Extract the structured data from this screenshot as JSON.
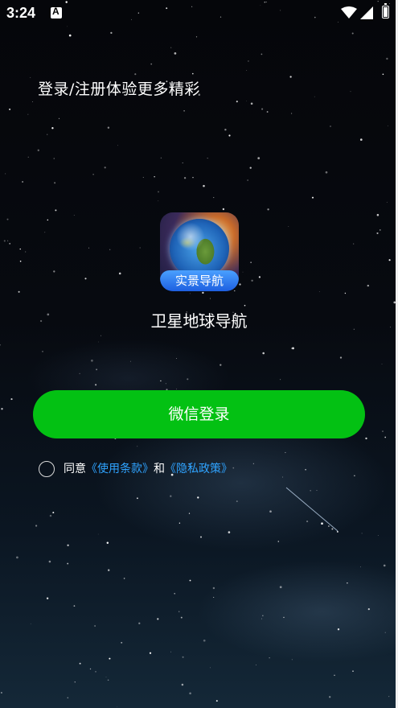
{
  "status_bar": {
    "time": "3:24",
    "icons": [
      "notification-a-icon",
      "wifi-icon",
      "signal-icon",
      "battery-charging-icon"
    ]
  },
  "headline": "登录/注册体验更多精彩",
  "app": {
    "icon_name": "globe-app-icon",
    "icon_badge": "实景导航",
    "name": "卫星地球导航"
  },
  "login_button": {
    "label": "微信登录",
    "color": "#03c113"
  },
  "agreement": {
    "prefix": "同意",
    "terms_link": "《使用条款》",
    "conjunction": "和",
    "privacy_link": "《隐私政策》",
    "link_color": "#2fa3ff"
  }
}
